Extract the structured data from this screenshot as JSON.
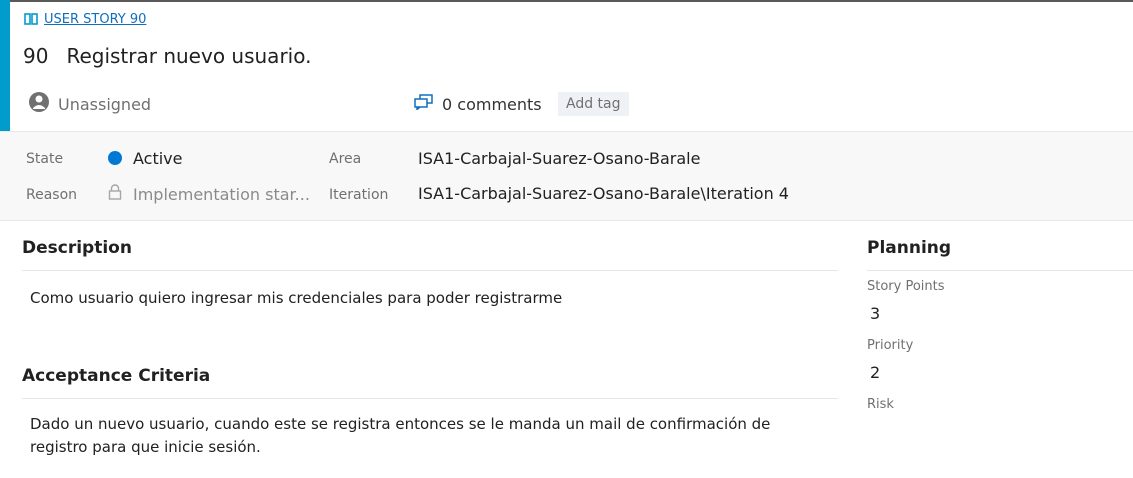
{
  "work_item": {
    "type_label": "USER STORY 90",
    "id": "90",
    "title": "Registrar nuevo usuario.",
    "assigned_to": "Unassigned",
    "comments": "0 comments",
    "add_tag": "Add tag"
  },
  "fields": {
    "state_label": "State",
    "state_value": "Active",
    "reason_label": "Reason",
    "reason_value": "Implementation star...",
    "area_label": "Area",
    "area_value": "ISA1-Carbajal-Suarez-Osano-Barale",
    "iteration_label": "Iteration",
    "iteration_value": "ISA1-Carbajal-Suarez-Osano-Barale\\Iteration 4"
  },
  "description": {
    "title": "Description",
    "text": "Como usuario quiero ingresar mis credenciales para poder registrarme"
  },
  "acceptance": {
    "title": "Acceptance Criteria",
    "text": "Dado un nuevo usuario, cuando este se registra entonces se le manda un mail de confirmación de registro para que inicie sesión."
  },
  "planning": {
    "title": "Planning",
    "story_points_label": "Story Points",
    "story_points_value": "3",
    "priority_label": "Priority",
    "priority_value": "2",
    "risk_label": "Risk"
  },
  "colors": {
    "accent": "#009ccc",
    "state_active": "#0078d4",
    "link": "#106ebe"
  },
  "icons": {
    "work_item_type": "book-icon",
    "assignee": "user-avatar-icon",
    "comments": "comments-icon",
    "reason_lock": "lock-icon"
  }
}
